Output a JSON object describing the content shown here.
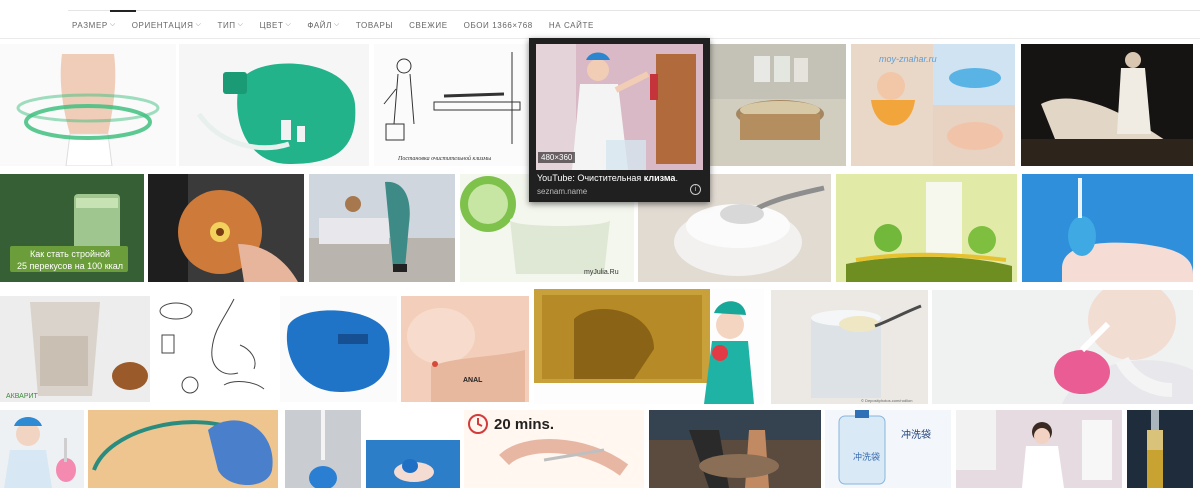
{
  "filters": [
    {
      "label": "РАЗМЕР",
      "dropdown": true,
      "active": true
    },
    {
      "label": "ОРИЕНТАЦИЯ",
      "dropdown": true
    },
    {
      "label": "ТИП",
      "dropdown": true
    },
    {
      "label": "ЦВЕТ",
      "dropdown": true
    },
    {
      "label": "ФАЙЛ",
      "dropdown": true
    },
    {
      "label": "ТОВАРЫ",
      "dropdown": false
    },
    {
      "label": "СВЕЖИЕ",
      "dropdown": false
    },
    {
      "label": "ОБОИ 1366×768",
      "dropdown": false
    },
    {
      "label": "НА САЙТЕ",
      "dropdown": false
    }
  ],
  "hover_card": {
    "dimensions": "480×360",
    "title_prefix": "YouTube: Очистительная ",
    "title_bold": "клизма",
    "title_suffix": ".",
    "domain": "seznam.name",
    "info_icon": "i"
  },
  "tile_texts": {
    "ad_line1": "Как стать стройной",
    "ad_line2": "25 перекусов на 100 ккал",
    "drawing_caption": "Постановка очистительной клизмы",
    "myjulia": "myJulia.Ru",
    "watermark_moy": "moy-znahar.ru",
    "time_badge": "20 mins.",
    "chinese": "冲洗袋",
    "akvarit": "АКВАРИТ",
    "depositphotos": "© Depositphotos.com/rodlion",
    "anal": "ANAL"
  },
  "colors": {
    "filter_text": "#666666",
    "active_underline": "#222222",
    "hovercard_bg": "#202020"
  }
}
